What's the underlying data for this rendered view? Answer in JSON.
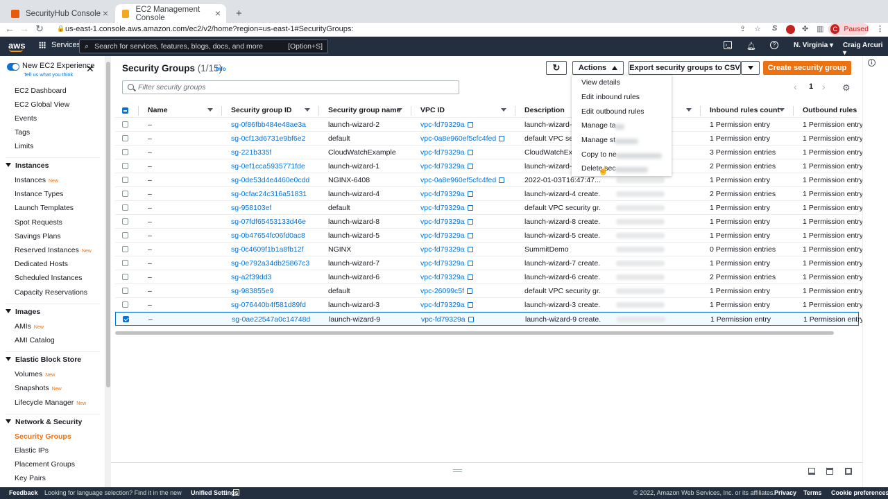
{
  "browser": {
    "tabs": [
      {
        "title": "SecurityHub Console",
        "favicon_color": "#e8590c"
      },
      {
        "title": "EC2 Management Console",
        "favicon_color": "#f5a623"
      }
    ],
    "new_tab": "+",
    "url": "us-east-1.console.aws.amazon.com/ec2/v2/home?region=us-east-1#SecurityGroups:",
    "profile_initial": "C",
    "profile_status": "Paused"
  },
  "awsnav": {
    "logo": "aws",
    "services": "Services",
    "search_placeholder": "Search for services, features, blogs, docs, and more",
    "search_shortcut": "[Option+S]",
    "region": "N. Virginia ▾",
    "user": "Craig Arcuri ▾"
  },
  "sidebar": {
    "new_experience": "New EC2 Experience",
    "tell_us": "Tell us what you think",
    "top_items": [
      "EC2 Dashboard",
      "EC2 Global View",
      "Events",
      "Tags",
      "Limits"
    ],
    "new_badge": "New",
    "sections": [
      {
        "title": "Instances",
        "items": [
          {
            "label": "Instances",
            "new": true
          },
          {
            "label": "Instance Types",
            "new": false
          },
          {
            "label": "Launch Templates",
            "new": false
          },
          {
            "label": "Spot Requests",
            "new": false
          },
          {
            "label": "Savings Plans",
            "new": false
          },
          {
            "label": "Reserved Instances",
            "new": true
          },
          {
            "label": "Dedicated Hosts",
            "new": false
          },
          {
            "label": "Scheduled Instances",
            "new": false
          },
          {
            "label": "Capacity Reservations",
            "new": false
          }
        ]
      },
      {
        "title": "Images",
        "items": [
          {
            "label": "AMIs",
            "new": true
          },
          {
            "label": "AMI Catalog",
            "new": false
          }
        ]
      },
      {
        "title": "Elastic Block Store",
        "items": [
          {
            "label": "Volumes",
            "new": true
          },
          {
            "label": "Snapshots",
            "new": true
          },
          {
            "label": "Lifecycle Manager",
            "new": true
          }
        ]
      },
      {
        "title": "Network & Security",
        "items": [
          {
            "label": "Security Groups",
            "new": false
          },
          {
            "label": "Elastic IPs",
            "new": false
          },
          {
            "label": "Placement Groups",
            "new": false
          },
          {
            "label": "Key Pairs",
            "new": false
          }
        ]
      }
    ]
  },
  "header": {
    "title": "Security Groups",
    "count": "(1/15)",
    "info": "Info",
    "actions": "Actions",
    "export": "Export security groups to CSV",
    "create": "Create security group",
    "filter_placeholder": "Filter security groups",
    "page": "1"
  },
  "actions_menu": [
    "View details",
    "Edit inbound rules",
    "Edit outbound rules",
    "Manage ta",
    "Manage st",
    "Copy to ne",
    "Delete sec"
  ],
  "table": {
    "columns": [
      "Name",
      "Security group ID",
      "Security group name",
      "VPC ID",
      "Description",
      "Inbound rules count",
      "Outbound rules co..."
    ],
    "rows": [
      {
        "name": "–",
        "id": "sg-0f86fbb484e48ae3a",
        "gname": "launch-wizard-2",
        "vpc": "vpc-fd79329a",
        "desc": "launch-wizard-2",
        "inbound": "1 Permission entry",
        "outbound": "1 Permission entry",
        "selected": false
      },
      {
        "name": "–",
        "id": "sg-0cf13d6731e9bf6e2",
        "gname": "default",
        "vpc": "vpc-0a8e960ef5cfc4fed",
        "desc": "default VPC secu",
        "inbound": "1 Permission entry",
        "outbound": "1 Permission entry",
        "selected": false
      },
      {
        "name": "–",
        "id": "sg-221b335f",
        "gname": "CloudWatchExample",
        "vpc": "vpc-fd79329a",
        "desc": "CloudWatchExar",
        "inbound": "3 Permission entries",
        "outbound": "1 Permission entry",
        "selected": false
      },
      {
        "name": "–",
        "id": "sg-0ef1cca5935771fde",
        "gname": "launch-wizard-1",
        "vpc": "vpc-fd79329a",
        "desc": "launch-wizard-1",
        "inbound": "2 Permission entries",
        "outbound": "1 Permission entry",
        "selected": false
      },
      {
        "name": "–",
        "id": "sg-0de53d4e4460e0cdd",
        "gname": "NGINX-6408",
        "vpc": "vpc-0a8e960ef5cfc4fed",
        "desc": "2022-01-03T16:47:47....",
        "inbound": "1 Permission entry",
        "outbound": "1 Permission entry",
        "selected": false
      },
      {
        "name": "–",
        "id": "sg-0cfac24c316a51831",
        "gname": "launch-wizard-4",
        "vpc": "vpc-fd79329a",
        "desc": "launch-wizard-4 create...",
        "inbound": "2 Permission entries",
        "outbound": "1 Permission entry",
        "selected": false
      },
      {
        "name": "–",
        "id": "sg-958103ef",
        "gname": "default",
        "vpc": "vpc-fd79329a",
        "desc": "default VPC security gr...",
        "inbound": "1 Permission entry",
        "outbound": "1 Permission entry",
        "selected": false
      },
      {
        "name": "–",
        "id": "sg-07fdf65453133d46e",
        "gname": "launch-wizard-8",
        "vpc": "vpc-fd79329a",
        "desc": "launch-wizard-8 create...",
        "inbound": "1 Permission entry",
        "outbound": "1 Permission entry",
        "selected": false
      },
      {
        "name": "–",
        "id": "sg-0b47654fc06fd0ac8",
        "gname": "launch-wizard-5",
        "vpc": "vpc-fd79329a",
        "desc": "launch-wizard-5 create...",
        "inbound": "1 Permission entry",
        "outbound": "1 Permission entry",
        "selected": false
      },
      {
        "name": "–",
        "id": "sg-0c4609f1b1a8fb12f",
        "gname": "NGINX",
        "vpc": "vpc-fd79329a",
        "desc": "SummitDemo",
        "inbound": "0 Permission entries",
        "outbound": "1 Permission entry",
        "selected": false
      },
      {
        "name": "–",
        "id": "sg-0e792a34db25867c3",
        "gname": "launch-wizard-7",
        "vpc": "vpc-fd79329a",
        "desc": "launch-wizard-7 create...",
        "inbound": "1 Permission entry",
        "outbound": "1 Permission entry",
        "selected": false
      },
      {
        "name": "–",
        "id": "sg-a2f39dd3",
        "gname": "launch-wizard-6",
        "vpc": "vpc-fd79329a",
        "desc": "launch-wizard-6 create...",
        "inbound": "2 Permission entries",
        "outbound": "1 Permission entry",
        "selected": false
      },
      {
        "name": "–",
        "id": "sg-983855e9",
        "gname": "default",
        "vpc": "vpc-26099c5f",
        "desc": "default VPC security gr...",
        "inbound": "1 Permission entry",
        "outbound": "1 Permission entry",
        "selected": false
      },
      {
        "name": "–",
        "id": "sg-076440b4f581d89fd",
        "gname": "launch-wizard-3",
        "vpc": "vpc-fd79329a",
        "desc": "launch-wizard-3 create...",
        "inbound": "1 Permission entry",
        "outbound": "1 Permission entry",
        "selected": false
      },
      {
        "name": "–",
        "id": "sg-0ae22547a0c14748d",
        "gname": "launch-wizard-9",
        "vpc": "vpc-fd79329a",
        "desc": "launch-wizard-9 create...",
        "inbound": "1 Permission entry",
        "outbound": "1 Permission entry",
        "selected": true
      }
    ]
  },
  "footer": {
    "feedback": "Feedback",
    "language": "Looking for language selection? Find it in the new",
    "unified": "Unified Settings",
    "copyright": "© 2022, Amazon Web Services, Inc. or its affiliates.",
    "privacy": "Privacy",
    "terms": "Terms",
    "cookie": "Cookie preferences"
  },
  "colors": {
    "accent": "#ec7211",
    "link": "#0972d3",
    "nav_bg": "#232f3e"
  }
}
